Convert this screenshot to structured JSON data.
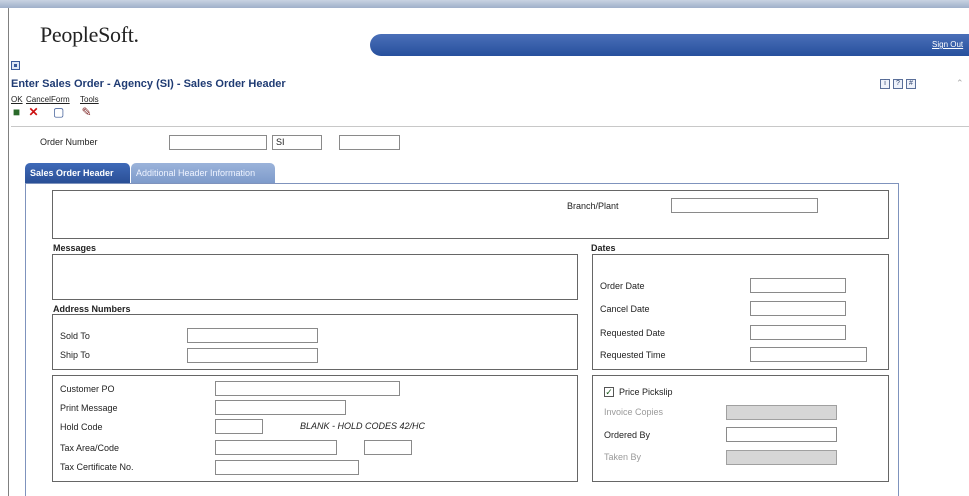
{
  "brand": {
    "logo": "PeopleSoft.",
    "sign_out": "Sign Out"
  },
  "page": {
    "title": "Enter Sales Order - Agency (SI) - Sales Order Header"
  },
  "title_icons": [
    "i",
    "?",
    "#"
  ],
  "toolbar": {
    "ok": "OK",
    "cancel": "Cancel",
    "form": "Form",
    "tools": "Tools"
  },
  "order": {
    "label": "Order Number",
    "number": "",
    "type": "SI",
    "company": ""
  },
  "tabs": {
    "active": "Sales Order Header",
    "inactive": "Additional Header Information"
  },
  "branch": {
    "label": "Branch/Plant",
    "value": ""
  },
  "sections": {
    "messages": "Messages",
    "address": "Address Numbers",
    "dates": "Dates"
  },
  "address": {
    "sold_to": "Sold To",
    "ship_to": "Ship To"
  },
  "dates": {
    "order_date": "Order Date",
    "cancel_date": "Cancel Date",
    "requested_date": "Requested Date",
    "requested_time": "Requested Time"
  },
  "customer": {
    "customer_po": "Customer PO",
    "print_message": "Print Message",
    "hold_code": "Hold Code",
    "hold_note": "BLANK - HOLD CODES 42/HC",
    "tax_area": "Tax Area/Code",
    "tax_cert": "Tax Certificate No."
  },
  "pick": {
    "price_pickslip": "Price Pickslip",
    "price_pickslip_checked": true,
    "invoice_copies": "Invoice Copies",
    "ordered_by": "Ordered By",
    "taken_by": "Taken By"
  },
  "colors": {
    "accent": "#27509d",
    "tab_active": "#2a4f96",
    "title": "#1f3b73"
  }
}
